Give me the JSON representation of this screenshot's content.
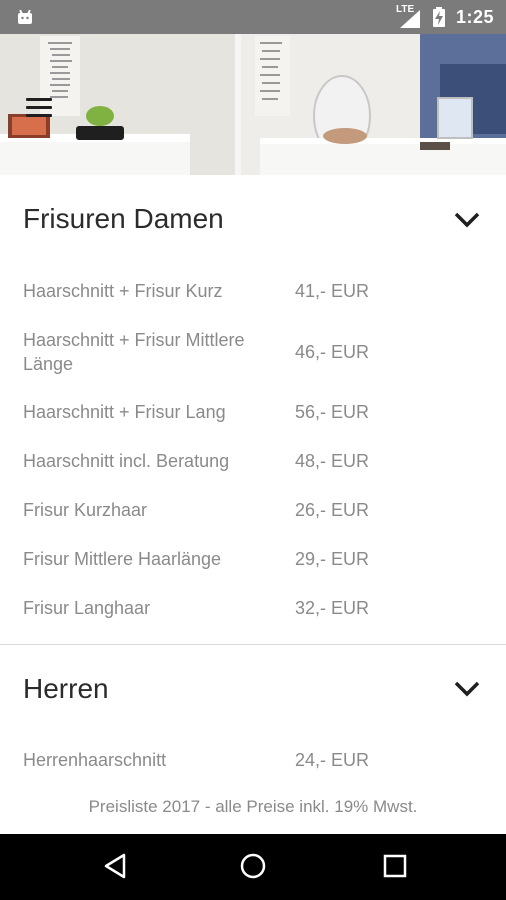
{
  "status_bar": {
    "network": "LTE",
    "time": "1:25"
  },
  "menu": {
    "icon": "hamburger-menu-icon"
  },
  "sections": [
    {
      "title": "Frisuren Damen",
      "items": [
        {
          "name": "Haarschnitt + Frisur Kurz",
          "price": "41,- EUR"
        },
        {
          "name": "Haarschnitt + Frisur Mittlere Länge",
          "price": "46,- EUR"
        },
        {
          "name": "Haarschnitt + Frisur Lang",
          "price": "56,- EUR"
        },
        {
          "name": "Haarschnitt incl. Beratung",
          "price": "48,- EUR"
        },
        {
          "name": "Frisur Kurzhaar",
          "price": "26,- EUR"
        },
        {
          "name": "Frisur Mittlere Haarlänge",
          "price": "29,- EUR"
        },
        {
          "name": "Frisur Langhaar",
          "price": "32,- EUR"
        }
      ]
    },
    {
      "title": "Herren",
      "items": [
        {
          "name": "Herrenhaarschnitt",
          "price": "24,- EUR"
        }
      ]
    }
  ],
  "footer": {
    "note": "Preisliste 2017 - alle Preise inkl. 19% Mwst."
  },
  "nav_bar": {
    "icons": [
      "back-icon",
      "home-icon",
      "recents-icon"
    ]
  },
  "colors": {
    "status_bar": "#7b7b7b",
    "nav_bar": "#000000",
    "text_primary": "#2b2b2b",
    "text_secondary": "#8a8a8a"
  }
}
